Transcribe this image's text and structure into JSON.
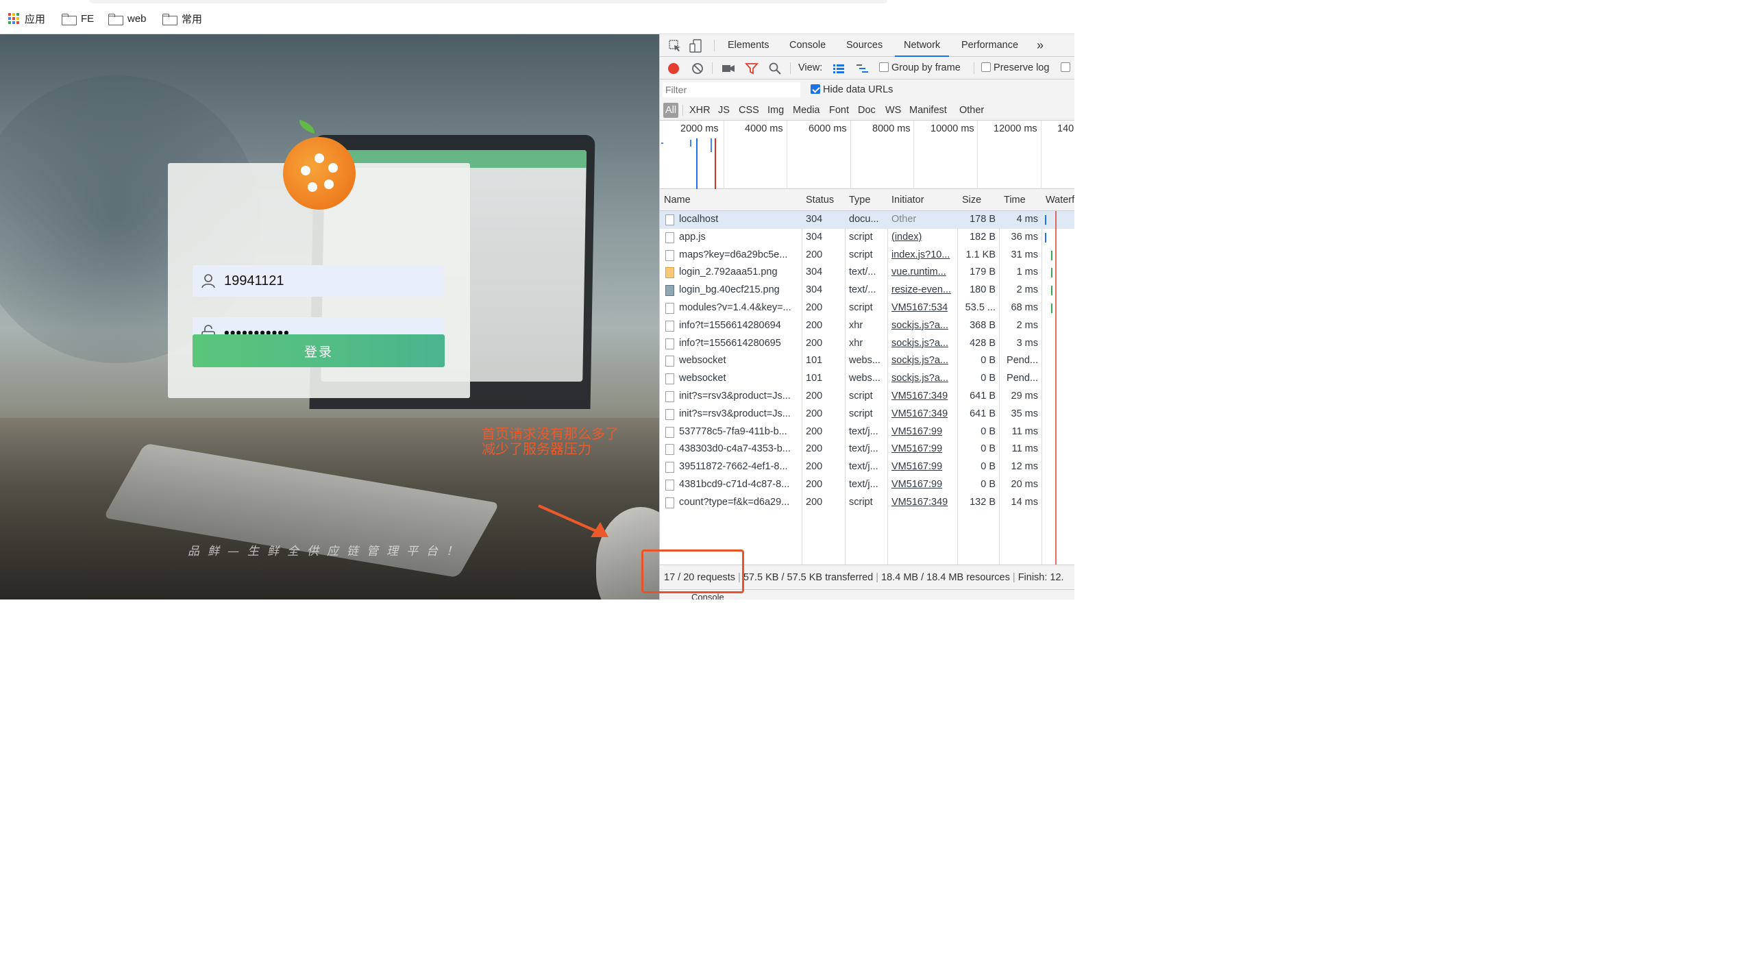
{
  "bookmarks": [
    {
      "label": "应用",
      "icon": "apps-grid-icon"
    },
    {
      "label": "FE",
      "icon": "folder-icon"
    },
    {
      "label": "web",
      "icon": "folder-icon"
    },
    {
      "label": "常用",
      "icon": "folder-icon"
    }
  ],
  "login": {
    "username_value": "19941121",
    "password_value": "•••••••••••",
    "submit_label": "登录",
    "slogan": "品鲜—生鲜全供应链管理平台！"
  },
  "annotation": {
    "line1": "首页请求没有那么多了",
    "line2": "减少了服务器压力",
    "color": "#ec5a2c"
  },
  "devtools": {
    "tabs": [
      "Elements",
      "Console",
      "Sources",
      "Network",
      "Performance"
    ],
    "active_tab": "Network",
    "more_tabs": "»",
    "toolbar": {
      "view_label": "View:",
      "group_by_frame": "Group by frame",
      "preserve_log": "Preserve log"
    },
    "filter": {
      "placeholder": "Filter",
      "hide_data_urls": "Hide data URLs",
      "hide_data_urls_checked": true
    },
    "types": [
      "All",
      "XHR",
      "JS",
      "CSS",
      "Img",
      "Media",
      "Font",
      "Doc",
      "WS",
      "Manifest",
      "Other"
    ],
    "active_type": "All",
    "timeline_ticks": [
      "2000 ms",
      "4000 ms",
      "6000 ms",
      "8000 ms",
      "10000 ms",
      "12000 ms",
      "140"
    ],
    "columns": [
      "Name",
      "Status",
      "Type",
      "Initiator",
      "Size",
      "Time",
      "Waterf"
    ],
    "requests": [
      {
        "name": "localhost",
        "status": "304",
        "type": "docu...",
        "initiator": "Other",
        "size": "178 B",
        "time": "4 ms",
        "icon": "document-icon"
      },
      {
        "name": "app.js",
        "status": "304",
        "type": "script",
        "initiator": "(index)",
        "size": "182 B",
        "time": "36 ms",
        "icon": "document-icon"
      },
      {
        "name": "maps?key=d6a29bc5e...",
        "status": "200",
        "type": "script",
        "initiator": "index.js?10...",
        "size": "1.1 KB",
        "time": "31 ms",
        "icon": "document-icon"
      },
      {
        "name": "login_2.792aaa51.png",
        "status": "304",
        "type": "text/...",
        "initiator": "vue.runtim...",
        "size": "179 B",
        "time": "1 ms",
        "icon": "image-orange-icon"
      },
      {
        "name": "login_bg.40ecf215.png",
        "status": "304",
        "type": "text/...",
        "initiator": "resize-even...",
        "size": "180 B",
        "time": "2 ms",
        "icon": "image-landscape-icon"
      },
      {
        "name": "modules?v=1.4.4&key=...",
        "status": "200",
        "type": "script",
        "initiator": "VM5167:534",
        "size": "53.5 ...",
        "time": "68 ms",
        "icon": "document-icon"
      },
      {
        "name": "info?t=1556614280694",
        "status": "200",
        "type": "xhr",
        "initiator": "sockjs.js?a...",
        "size": "368 B",
        "time": "2 ms",
        "icon": "document-icon"
      },
      {
        "name": "info?t=1556614280695",
        "status": "200",
        "type": "xhr",
        "initiator": "sockjs.js?a...",
        "size": "428 B",
        "time": "3 ms",
        "icon": "document-icon"
      },
      {
        "name": "websocket",
        "status": "101",
        "type": "webs...",
        "initiator": "sockjs.js?a...",
        "size": "0 B",
        "time": "Pend...",
        "icon": "document-icon"
      },
      {
        "name": "websocket",
        "status": "101",
        "type": "webs...",
        "initiator": "sockjs.js?a...",
        "size": "0 B",
        "time": "Pend...",
        "icon": "document-icon"
      },
      {
        "name": "init?s=rsv3&product=Js...",
        "status": "200",
        "type": "script",
        "initiator": "VM5167:349",
        "size": "641 B",
        "time": "29 ms",
        "icon": "document-icon"
      },
      {
        "name": "init?s=rsv3&product=Js...",
        "status": "200",
        "type": "script",
        "initiator": "VM5167:349",
        "size": "641 B",
        "time": "35 ms",
        "icon": "document-icon"
      },
      {
        "name": "537778c5-7fa9-411b-b...",
        "status": "200",
        "type": "text/j...",
        "initiator": "VM5167:99",
        "size": "0 B",
        "time": "11 ms",
        "icon": "document-icon"
      },
      {
        "name": "438303d0-c4a7-4353-b...",
        "status": "200",
        "type": "text/j...",
        "initiator": "VM5167:99",
        "size": "0 B",
        "time": "11 ms",
        "icon": "document-icon"
      },
      {
        "name": "39511872-7662-4ef1-8...",
        "status": "200",
        "type": "text/j...",
        "initiator": "VM5167:99",
        "size": "0 B",
        "time": "12 ms",
        "icon": "document-icon"
      },
      {
        "name": "4381bcd9-c71d-4c87-8...",
        "status": "200",
        "type": "text/j...",
        "initiator": "VM5167:99",
        "size": "0 B",
        "time": "20 ms",
        "icon": "document-icon"
      },
      {
        "name": "count?type=f&k=d6a29...",
        "status": "200",
        "type": "script",
        "initiator": "VM5167:349",
        "size": "132 B",
        "time": "14 ms",
        "icon": "document-icon"
      }
    ],
    "status_bar": {
      "requests": "17 / 20 requests",
      "transferred": "57.5 KB / 57.5 KB transferred",
      "resources": "18.4 MB / 18.4 MB resources",
      "finish": "Finish: 12."
    },
    "drawer_label": "Console"
  }
}
